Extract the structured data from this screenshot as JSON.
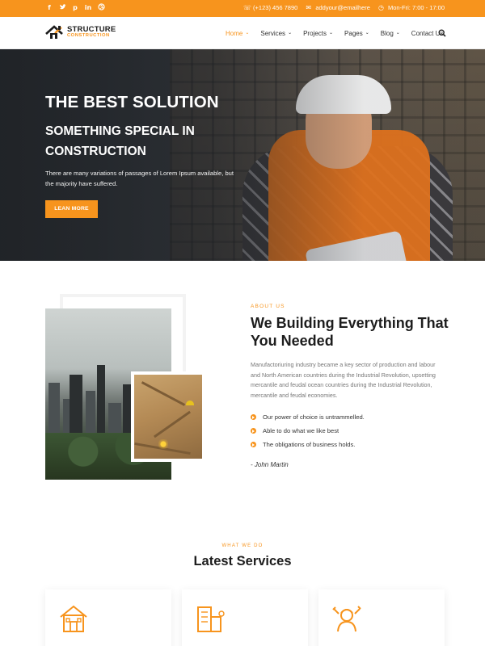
{
  "topbar": {
    "social": [
      "f",
      "t",
      "p",
      "in",
      "d"
    ],
    "phone": "(+123) 456 7890",
    "email": "addyour@emailhere",
    "hours": "Mon-Fri: 7:00 - 17:00"
  },
  "logo": {
    "title": "STRUCTURE",
    "subtitle": "CONSTRUCTION"
  },
  "nav": [
    {
      "label": "Home",
      "dropdown": true,
      "active": true
    },
    {
      "label": "Services",
      "dropdown": true
    },
    {
      "label": "Projects",
      "dropdown": true
    },
    {
      "label": "Pages",
      "dropdown": true
    },
    {
      "label": "Blog",
      "dropdown": true
    },
    {
      "label": "Contact Us",
      "dropdown": false
    }
  ],
  "hero": {
    "title": "THE BEST SOLUTION",
    "subtitle": "SOMETHING SPECIAL IN CONSTRUCTION",
    "text": "There are many variations of passages of Lorem Ipsum available, but the majority have suffered.",
    "button": "LEAN MORE"
  },
  "about": {
    "eyebrow": "ABOUT US",
    "title": "We Building Everything That You Needed",
    "paragraph": "Manufactoriuring industry became a key sector of production and labour and North American countries during the Industrial Revolution, upsetting mercantile and feudal ocean countries during the Industrial Revolution, mercantile and feudal economies.",
    "items": [
      "Our power of choice is untrammelled.",
      "Able to do what we like best",
      "The obligations of business holds."
    ],
    "author": "- John Martin"
  },
  "services": {
    "eyebrow": "WHAT WE DO",
    "title": "Latest Services"
  },
  "colors": {
    "accent": "#f7941d",
    "dark": "#1d1d1d"
  }
}
